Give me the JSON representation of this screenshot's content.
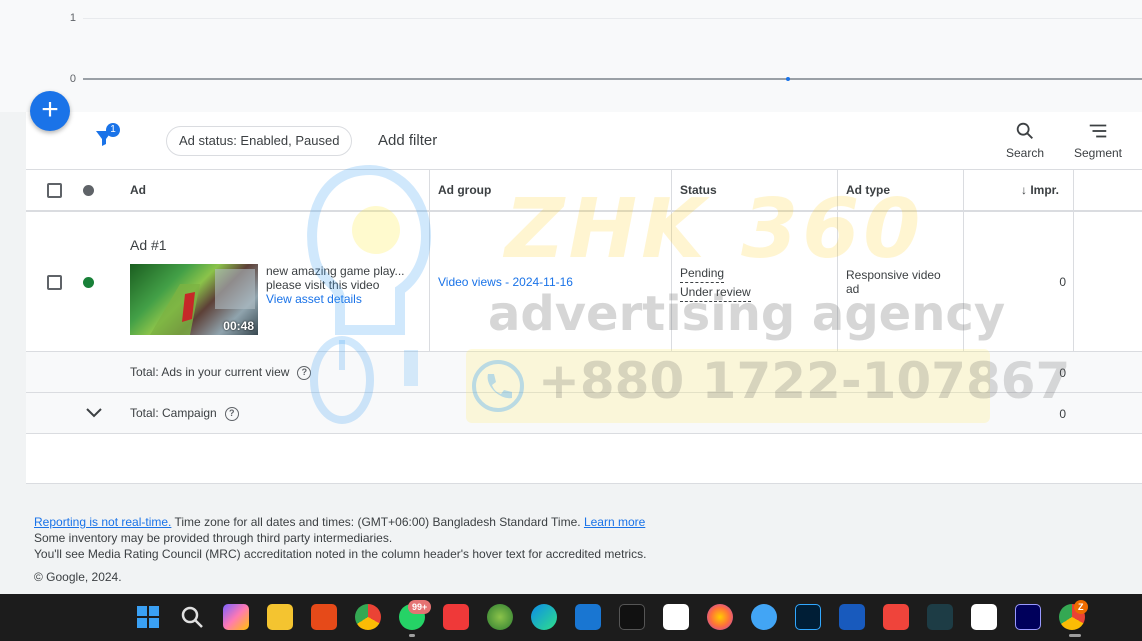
{
  "chart": {
    "ticks": [
      "1",
      "0"
    ]
  },
  "chart_data": {
    "type": "line",
    "xlabel": "",
    "ylabel": "",
    "ylim": [
      0,
      1
    ],
    "series": [
      {
        "values": [
          0
        ]
      }
    ],
    "grid": true
  },
  "fab": {
    "label": "+"
  },
  "toolbar": {
    "filter_count": "1",
    "chip_label": "Ad status: Enabled, Paused",
    "add_filter": "Add filter",
    "search_label": "Search",
    "segment_label": "Segment"
  },
  "table": {
    "headers": {
      "ad": "Ad",
      "ad_group": "Ad group",
      "status": "Status",
      "ad_type": "Ad type",
      "impr": "Impr."
    },
    "row": {
      "title": "Ad #1",
      "duration": "00:48",
      "desc_line1": "new amazing game play...",
      "desc_line2": "please visit this video",
      "asset_link": "View asset details",
      "ad_group": "Video views - 2024-11-16",
      "status1": "Pending",
      "status2": "Under review",
      "ad_type": "Responsive video ad",
      "impr": "0"
    },
    "totals": [
      {
        "label": "Total: Ads in your current view",
        "impr": "0"
      },
      {
        "label": "Total: Campaign",
        "impr": "0"
      }
    ]
  },
  "watermark": {
    "brand": "ZHK 360",
    "sub": "advertising agency",
    "phone": "+880 1722-107867"
  },
  "footer": {
    "link1": "Reporting is not real-time.",
    "line1_text": " Time zone for all dates and times: (GMT+06:00) Bangladesh Standard Time. ",
    "link2": "Learn more",
    "line2": "Some inventory may be provided through third party intermediaries.",
    "line3": "You'll see Media Rating Council (MRC) accreditation noted in the column header's hover text for accredited metrics.",
    "copyright": "© Google, 2024."
  },
  "taskbar": {
    "whatsapp_badge": "99+",
    "chrome_badge": "Z",
    "colors": {
      "start": "#3aa0f3",
      "search": "#e0e0e0",
      "copilot": "#7b61ff",
      "files": "#f4c430",
      "snip": "#e64a19",
      "chrome": "#4caf50",
      "whatsapp": "#25d366",
      "vivaldi": "#ef3939",
      "photos": "#2e7d32",
      "edge": "#0c8ce9",
      "store": "#1976d2",
      "pycharm": "#111111",
      "capcut": "#ffffff",
      "firefox": "#ff7139",
      "sync": "#42a5f5",
      "photoshop": "#001e36",
      "word": "#185abd",
      "anydesk": "#ef443b",
      "filmora": "#1d3c45",
      "premiere": "#00005b"
    }
  }
}
